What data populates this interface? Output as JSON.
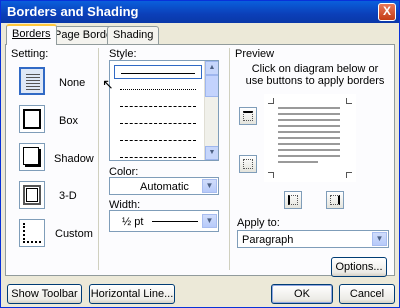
{
  "window": {
    "title": "Borders and Shading",
    "close_glyph": "X"
  },
  "tabs": [
    {
      "label": "Borders",
      "active": true
    },
    {
      "label": "Page Border",
      "active": false
    },
    {
      "label": "Shading",
      "active": false
    }
  ],
  "setting": {
    "label": "Setting:",
    "options": [
      {
        "label": "None",
        "selected": true,
        "icon": "setting-none-icon"
      },
      {
        "label": "Box",
        "selected": false,
        "icon": "setting-box-icon"
      },
      {
        "label": "Shadow",
        "selected": false,
        "icon": "setting-shadow-icon"
      },
      {
        "label": "3-D",
        "selected": false,
        "icon": "setting-3d-icon"
      },
      {
        "label": "Custom",
        "selected": false,
        "icon": "setting-custom-icon"
      }
    ]
  },
  "style": {
    "label": "Style:",
    "items": [
      "solid",
      "dotted",
      "dashed-small",
      "dashed",
      "dash-dot",
      "dash-dot-dot"
    ]
  },
  "color": {
    "label": "Color:",
    "value": "Automatic"
  },
  "width": {
    "label": "Width:",
    "value": "½ pt"
  },
  "preview": {
    "label": "Preview",
    "hint": "Click on diagram below or use buttons to apply borders"
  },
  "apply_to": {
    "label": "Apply to:",
    "value": "Paragraph"
  },
  "buttons": {
    "options": "Options...",
    "show_toolbar": "Show Toolbar",
    "horizontal_line": "Horizontal Line...",
    "ok": "OK",
    "cancel": "Cancel"
  },
  "colors": {
    "titlebar": "#0b3fb8",
    "dialog_bg": "#ece9d8",
    "selection": "#316ac5"
  }
}
